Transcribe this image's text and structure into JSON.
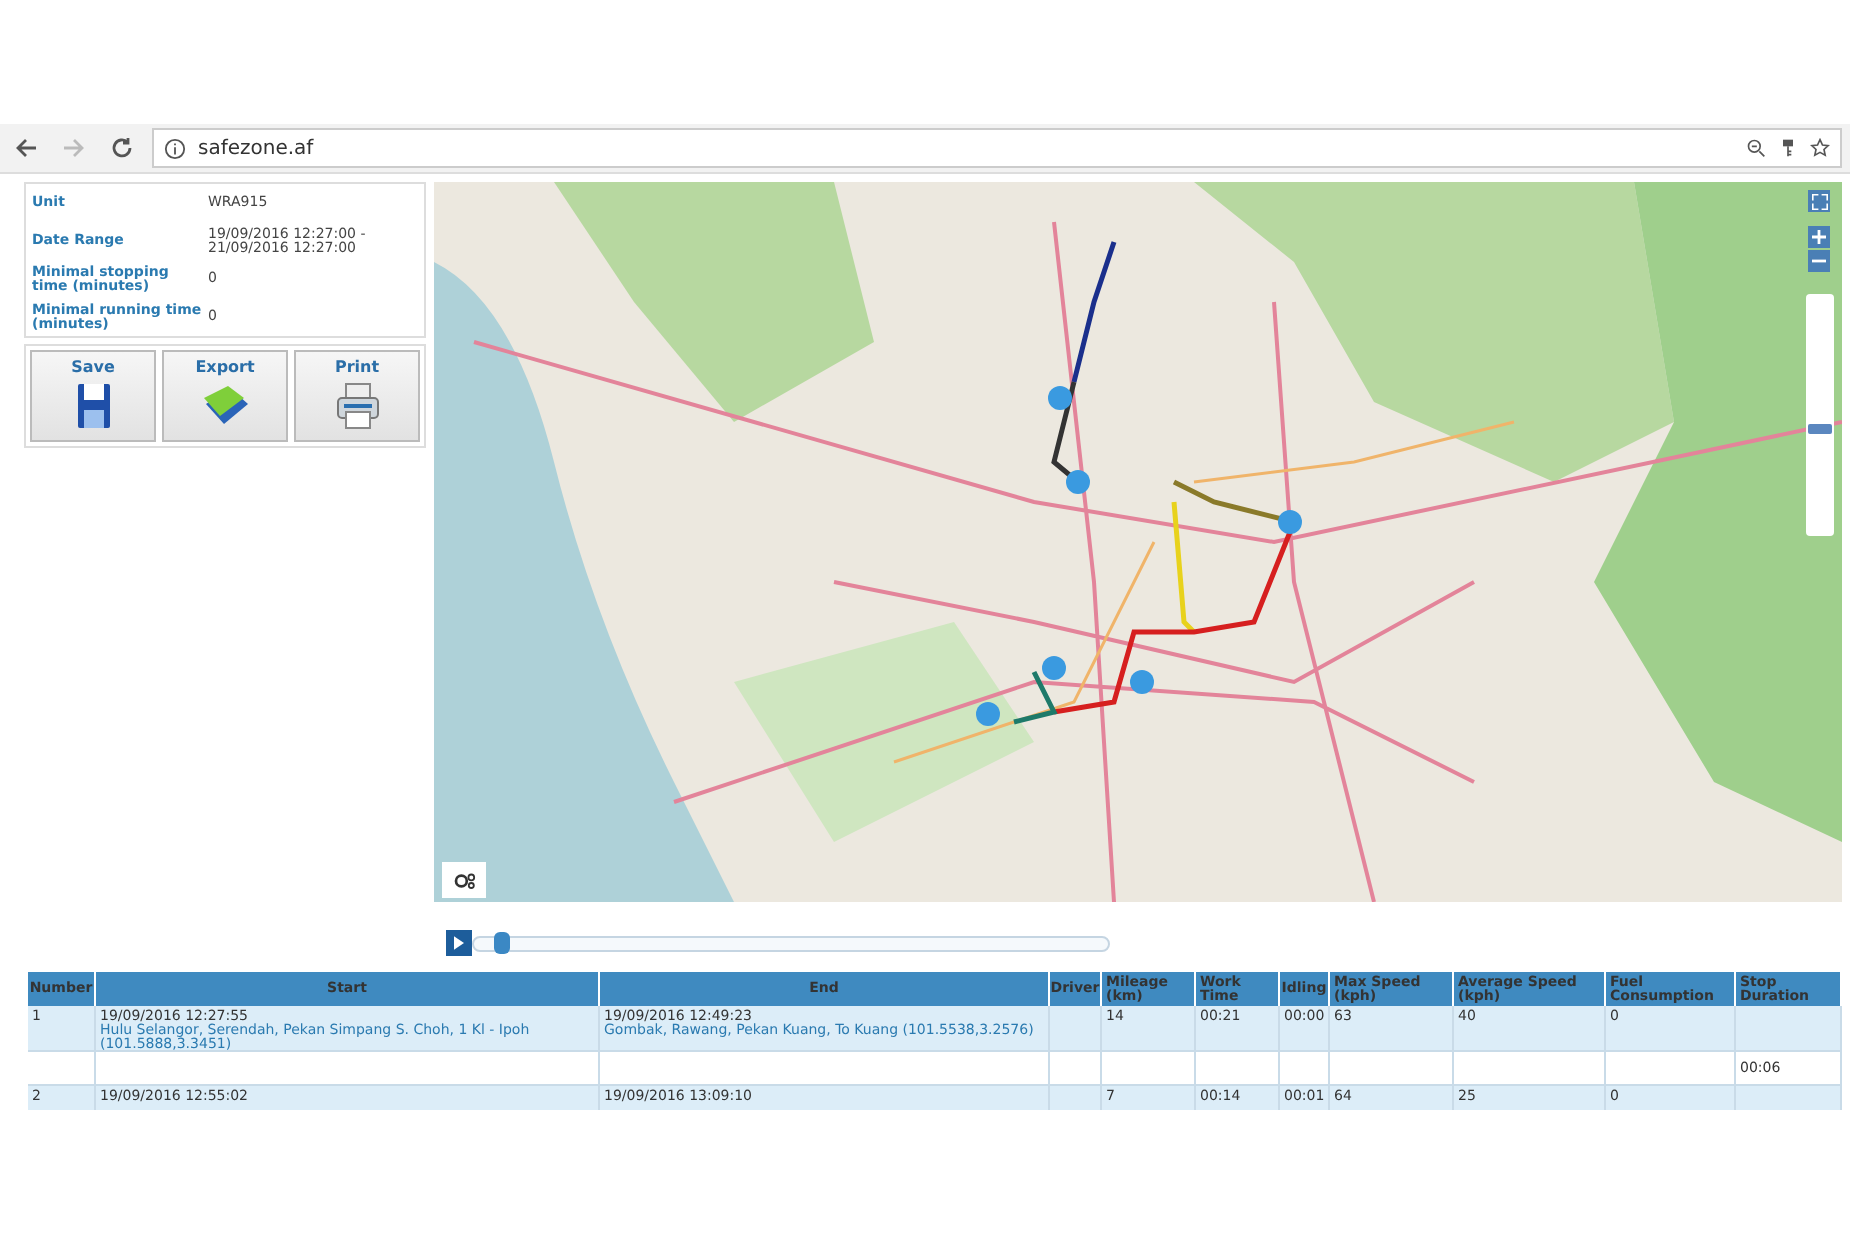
{
  "browser": {
    "url": "safezone.af"
  },
  "report_info": [
    {
      "label": "Unit",
      "value": "WRA915"
    },
    {
      "label": "Date Range",
      "value": "19/09/2016 12:27:00 - 21/09/2016 12:27:00"
    },
    {
      "label": "Minimal stopping time (minutes)",
      "value": "0"
    },
    {
      "label": "Minimal running time (minutes)",
      "value": "0"
    }
  ],
  "actions": [
    {
      "label": "Save",
      "kind": "save"
    },
    {
      "label": "Export",
      "kind": "export"
    },
    {
      "label": "Print",
      "kind": "print"
    }
  ],
  "map": {
    "zoom_slider": {
      "level": 0.42
    }
  },
  "playback": {
    "level": 0.03
  },
  "table": {
    "columns": [
      "Number",
      "Start",
      "End",
      "Driver",
      "Mileage (km)",
      "Work Time",
      "Idling",
      "Max Speed (kph)",
      "Average Speed (kph)",
      "Fuel Consumption",
      "Stop Duration"
    ],
    "rows": [
      {
        "kind": "trip",
        "number": "1",
        "start_time": "19/09/2016 12:27:55",
        "start_address": "Hulu Selangor, Serendah, Pekan Simpang S. Choh, 1 Kl - Ipoh (101.5888,3.3451)",
        "end_time": "19/09/2016 12:49:23",
        "end_address": "Gombak, Rawang, Pekan Kuang, To Kuang (101.5538,3.2576)",
        "mileage": "14",
        "work_time": "00:21",
        "idling": "00:00",
        "max_speed": "63",
        "avg_speed": "40",
        "fuel": "0"
      },
      {
        "kind": "stop",
        "stop_duration": "00:06"
      },
      {
        "kind": "trip",
        "number": "2",
        "start_time": "19/09/2016 12:55:02",
        "end_time": "19/09/2016 13:09:10",
        "mileage": "7",
        "work_time": "00:14",
        "idling": "00:01",
        "max_speed": "64",
        "avg_speed": "25",
        "fuel": "0"
      }
    ]
  }
}
